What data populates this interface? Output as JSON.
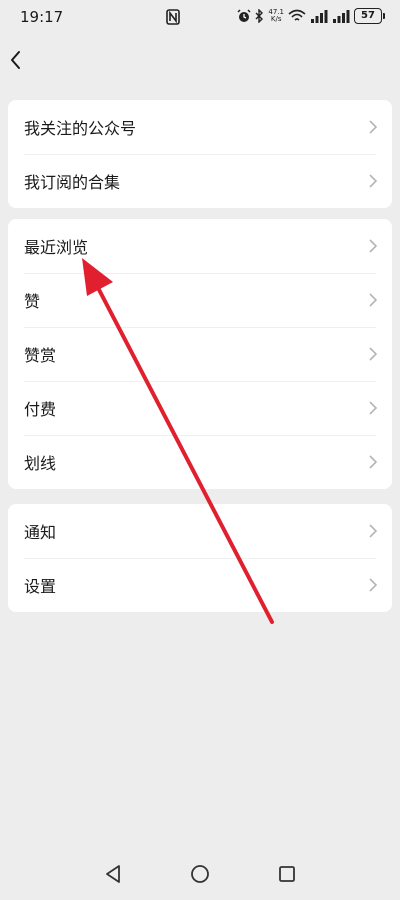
{
  "status_bar": {
    "time": "19:17",
    "network_speed_value": "47.1",
    "network_speed_unit": "K/s",
    "battery": "57"
  },
  "sections": [
    {
      "items": [
        {
          "label": "我关注的公众号"
        },
        {
          "label": "我订阅的合集"
        }
      ]
    },
    {
      "items": [
        {
          "label": "最近浏览"
        },
        {
          "label": "赞"
        },
        {
          "label": "赞赏"
        },
        {
          "label": "付费"
        },
        {
          "label": "划线"
        }
      ]
    },
    {
      "items": [
        {
          "label": "通知"
        },
        {
          "label": "设置"
        }
      ]
    }
  ],
  "colors": {
    "background": "#ededed",
    "card": "#ffffff",
    "annotation_arrow": "#e0202f"
  }
}
